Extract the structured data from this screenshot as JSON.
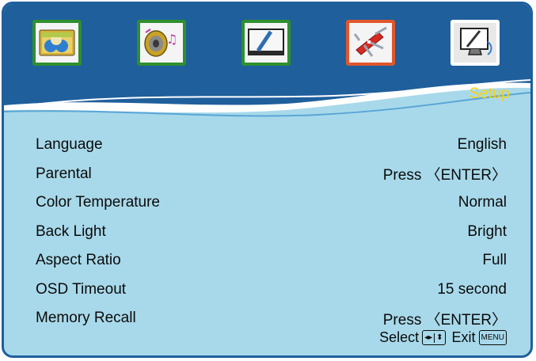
{
  "colors": {
    "background": "#a8d9ea",
    "frame": "#1f5f9c",
    "header_wave": "#1f5f9c",
    "title": "#ffd200",
    "text": "#0b0b0b"
  },
  "tabs": [
    {
      "icon": "picture-icon",
      "state": "inactive"
    },
    {
      "icon": "audio-icon",
      "state": "inactive"
    },
    {
      "icon": "display-icon",
      "state": "inactive"
    },
    {
      "icon": "tools-icon",
      "state": "inactive"
    },
    {
      "icon": "setup-monitor-icon",
      "state": "selected"
    }
  ],
  "header": {
    "section_title": "Setup"
  },
  "menu": {
    "items": [
      {
        "label": "Language",
        "value": "English"
      },
      {
        "label": "Parental",
        "value": "Press 〈ENTER〉"
      },
      {
        "label": "Color Temperature",
        "value": "Normal"
      },
      {
        "label": "Back Light",
        "value": "Bright"
      },
      {
        "label": "Aspect Ratio",
        "value": "Full"
      },
      {
        "label": "OSD Timeout",
        "value": "15 second"
      },
      {
        "label": "Memory Recall",
        "value": "Press 〈ENTER〉"
      }
    ]
  },
  "footer": {
    "select_label": "Select",
    "exit_label": "Exit",
    "exit_key": "MENU",
    "select_keys_icon": "left-right-up-down-keys-icon"
  }
}
